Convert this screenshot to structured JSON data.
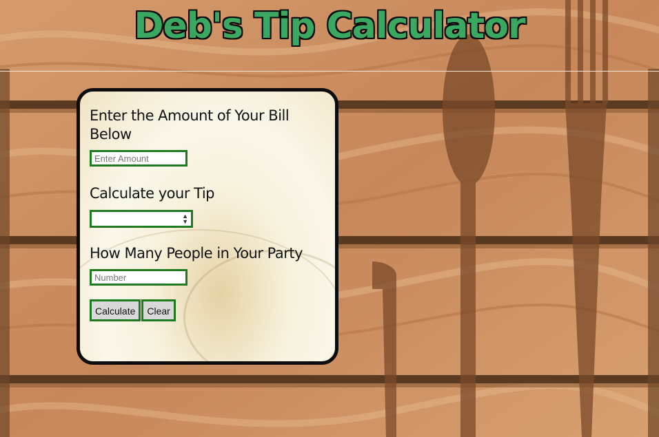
{
  "app": {
    "title": "Deb's Tip Calculator"
  },
  "form": {
    "bill_label": "Enter the Amount of Your Bill Below",
    "bill_placeholder": "Enter Amount",
    "tip_label": "Calculate your Tip",
    "tip_selected": "",
    "party_label": "How Many People in Your Party",
    "party_placeholder": "Number",
    "calculate_label": "Calculate",
    "clear_label": "Clear"
  },
  "colors": {
    "title_green": "#3aa860",
    "border_green": "#1e7a1e",
    "wood": "#c98a5c"
  }
}
